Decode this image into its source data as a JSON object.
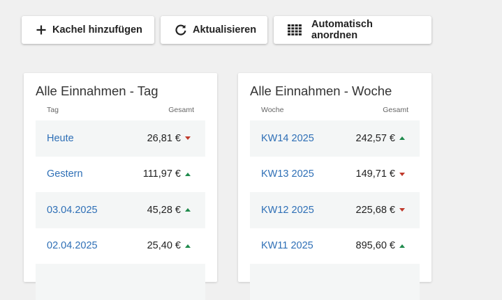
{
  "toolbar": {
    "add_label": "Kachel hinzufügen",
    "refresh_label": "Aktualisieren",
    "auto_label": "Automatisch anordnen"
  },
  "tiles": [
    {
      "title": "Alle Einnahmen - Tag",
      "col_left": "Tag",
      "col_right": "Gesamt",
      "rows": [
        {
          "label": "Heute",
          "value": "26,81 €",
          "trend": "down"
        },
        {
          "label": "Gestern",
          "value": "111,97 €",
          "trend": "up"
        },
        {
          "label": "03.04.2025",
          "value": "45,28 €",
          "trend": "up"
        },
        {
          "label": "02.04.2025",
          "value": "25,40 €",
          "trend": "up"
        }
      ]
    },
    {
      "title": "Alle Einnahmen - Woche",
      "col_left": "Woche",
      "col_right": "Gesamt",
      "rows": [
        {
          "label": "KW14 2025",
          "value": "242,57 €",
          "trend": "up"
        },
        {
          "label": "KW13 2025",
          "value": "149,71 €",
          "trend": "down"
        },
        {
          "label": "KW12 2025",
          "value": "225,68 €",
          "trend": "down"
        },
        {
          "label": "KW11 2025",
          "value": "895,60 €",
          "trend": "up"
        }
      ]
    }
  ],
  "colors": {
    "link": "#2e6fb6",
    "trend_up": "#1f8a4c",
    "trend_down": "#c0392b",
    "background": "#f0f0f0"
  }
}
